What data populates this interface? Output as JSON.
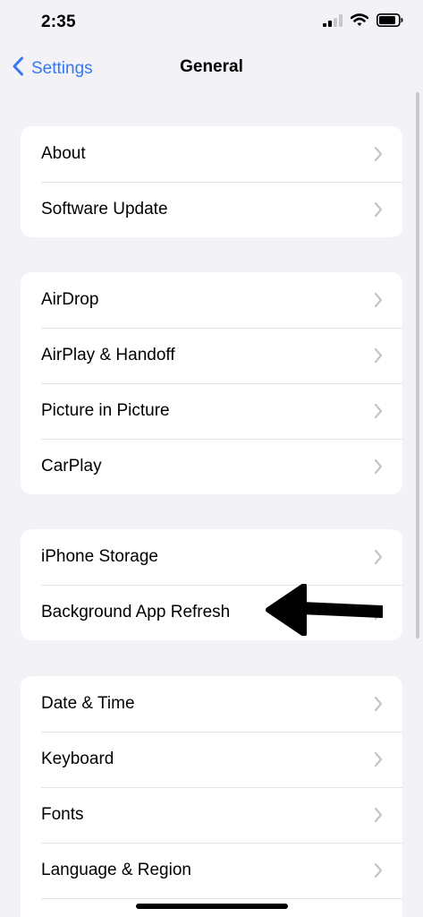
{
  "status_bar": {
    "time": "2:35"
  },
  "nav": {
    "back_label": "Settings",
    "title": "General"
  },
  "groups": [
    {
      "items": [
        {
          "label": "About"
        },
        {
          "label": "Software Update"
        }
      ]
    },
    {
      "items": [
        {
          "label": "AirDrop"
        },
        {
          "label": "AirPlay & Handoff"
        },
        {
          "label": "Picture in Picture"
        },
        {
          "label": "CarPlay"
        }
      ]
    },
    {
      "items": [
        {
          "label": "iPhone Storage"
        },
        {
          "label": "Background App Refresh"
        }
      ]
    },
    {
      "items": [
        {
          "label": "Date & Time"
        },
        {
          "label": "Keyboard"
        },
        {
          "label": "Fonts"
        },
        {
          "label": "Language & Region"
        }
      ]
    }
  ],
  "colors": {
    "accent": "#3478f6",
    "background": "#f2f2f7",
    "card": "#ffffff",
    "chevron": "#c4c4c7",
    "annotation_arrow": "#000000"
  },
  "icons": {
    "back": "chevron-left-icon",
    "row": "chevron-right-icon",
    "signal": "cellular-signal-icon",
    "wifi": "wifi-icon",
    "battery": "battery-icon",
    "annotation": "arrow-left-icon"
  }
}
